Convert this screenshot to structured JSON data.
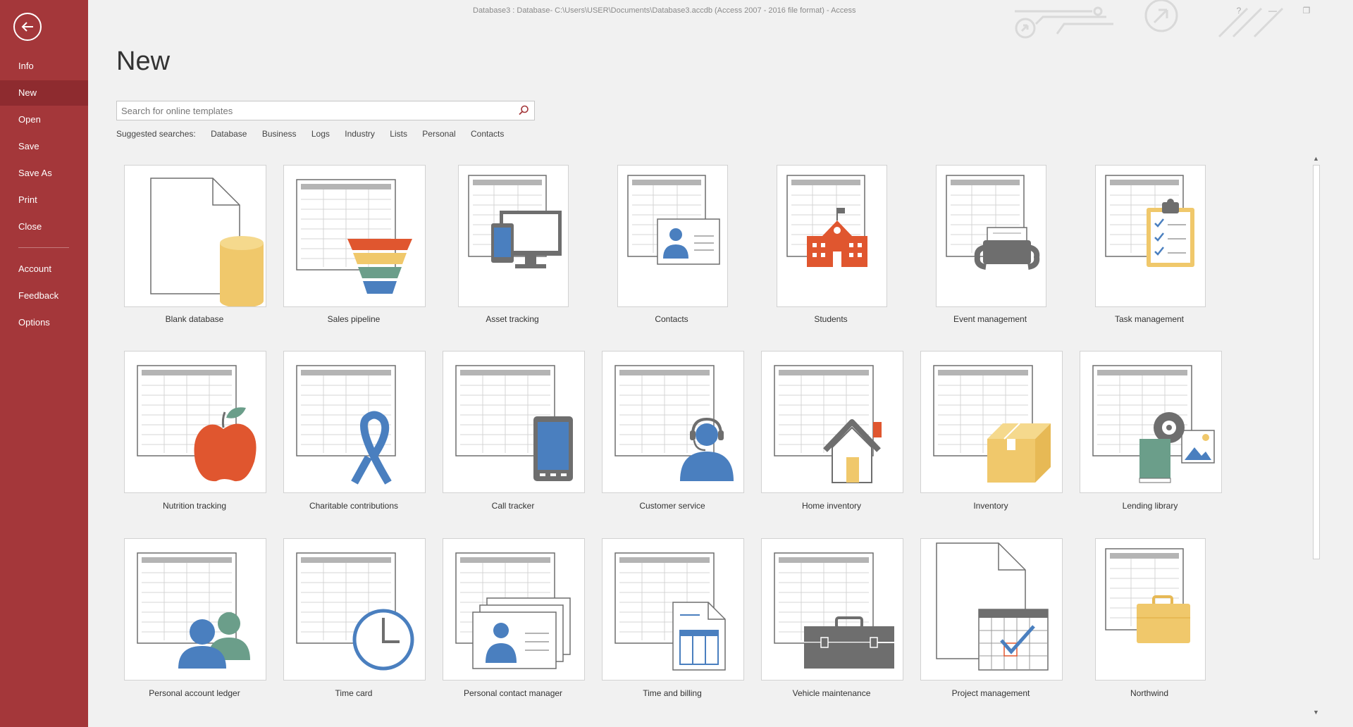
{
  "window": {
    "title": "Database3 : Database- C:\\Users\\USER\\Documents\\Database3.accdb (Access 2007 - 2016 file format)  -  Access",
    "help_label": "?",
    "minimize_label": "—",
    "restore_label": "❐"
  },
  "sidebar": {
    "items": [
      {
        "label": "Info"
      },
      {
        "label": "New",
        "active": true
      },
      {
        "label": "Open"
      },
      {
        "label": "Save"
      },
      {
        "label": "Save As"
      },
      {
        "label": "Print"
      },
      {
        "label": "Close"
      },
      {
        "label": "Account"
      },
      {
        "label": "Feedback"
      },
      {
        "label": "Options"
      }
    ]
  },
  "main": {
    "title": "New",
    "search": {
      "placeholder": "Search for online templates"
    },
    "suggested": {
      "label": "Suggested searches:",
      "items": [
        "Database",
        "Business",
        "Logs",
        "Industry",
        "Lists",
        "Personal",
        "Contacts"
      ]
    },
    "templates": [
      {
        "label": "Blank database",
        "icon": "blank-database-icon"
      },
      {
        "label": "Sales pipeline",
        "icon": "funnel-icon"
      },
      {
        "label": "Asset tracking",
        "icon": "devices-icon"
      },
      {
        "label": "Contacts",
        "icon": "contact-card-icon"
      },
      {
        "label": "Students",
        "icon": "school-icon"
      },
      {
        "label": "Event management",
        "icon": "telephone-icon"
      },
      {
        "label": "Task management",
        "icon": "clipboard-checklist-icon"
      },
      {
        "label": "Nutrition tracking",
        "icon": "apple-icon"
      },
      {
        "label": "Charitable contributions",
        "icon": "ribbon-icon"
      },
      {
        "label": "Call tracker",
        "icon": "phone-icon"
      },
      {
        "label": "Customer service",
        "icon": "headset-agent-icon"
      },
      {
        "label": "Home inventory",
        "icon": "house-icon"
      },
      {
        "label": "Inventory",
        "icon": "box-icon"
      },
      {
        "label": "Lending library",
        "icon": "book-disc-picture-icon"
      },
      {
        "label": "Personal account ledger",
        "icon": "people-icon"
      },
      {
        "label": "Time card",
        "icon": "clock-icon"
      },
      {
        "label": "Personal contact manager",
        "icon": "contact-cards-icon"
      },
      {
        "label": "Time and billing",
        "icon": "invoice-document-icon"
      },
      {
        "label": "Vehicle maintenance",
        "icon": "toolbox-icon"
      },
      {
        "label": "Project management",
        "icon": "calendar-check-icon"
      },
      {
        "label": "Northwind",
        "icon": "briefcase-icon"
      }
    ]
  },
  "colors": {
    "accent": "#a4373a",
    "accent_dark": "#8e2b2f",
    "blue": "#4a7fbf",
    "yellow": "#f0c86b",
    "orange": "#e0562f",
    "green": "#6b9e8a",
    "gray": "#6e6e6e"
  }
}
